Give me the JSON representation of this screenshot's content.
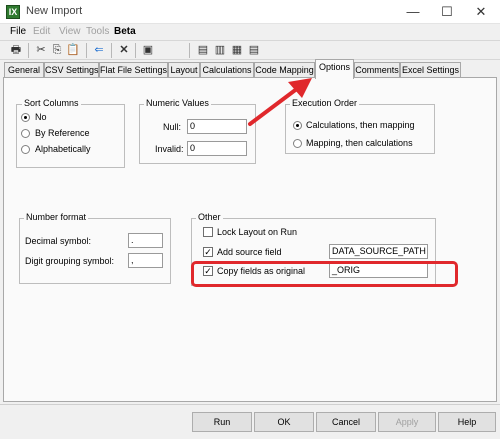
{
  "window": {
    "app_icon": "IX",
    "title": "New Import",
    "controls": {
      "minimize": "—",
      "maximize": "☐",
      "close": "✕"
    }
  },
  "menu": {
    "items": [
      "File",
      "Edit",
      "View",
      "Tools",
      "Beta"
    ],
    "disabled": [
      "Edit",
      "View",
      "Tools"
    ]
  },
  "toolbar": {
    "icons": [
      "print-icon",
      "cut-icon",
      "copy-icon",
      "paste-icon",
      "back-arrow-icon",
      "delete-icon",
      "properties-icon",
      "layout-view-1-icon",
      "layout-view-2-icon",
      "layout-view-3-icon"
    ],
    "glyphs": {
      "print": "🖶",
      "cut": "✂",
      "copy": "⎘",
      "paste": "📋",
      "back": "⇐",
      "delete": "✕",
      "properties": "▣",
      "view1": "▤",
      "view2": "▥",
      "view3": "▦"
    }
  },
  "tabs": {
    "items": [
      "General",
      "CSV Settings",
      "Flat File Settings",
      "Layout",
      "Calculations",
      "Code Mapping",
      "Options",
      "Comments",
      "Excel Settings"
    ],
    "active": "Options"
  },
  "sort_columns": {
    "title": "Sort Columns",
    "options": [
      "No",
      "By Reference",
      "Alphabetically"
    ],
    "selected": "No"
  },
  "numeric_values": {
    "title": "Numeric Values",
    "null_label": "Null:",
    "null_value": "0",
    "invalid_label": "Invalid:",
    "invalid_value": "0"
  },
  "execution_order": {
    "title": "Execution Order",
    "options": [
      "Calculations, then mapping",
      "Mapping, then calculations"
    ],
    "selected": "Calculations, then mapping"
  },
  "number_format": {
    "title": "Number format",
    "decimal_label": "Decimal symbol:",
    "decimal_value": ".",
    "grouping_label": "Digit grouping symbol:",
    "grouping_value": ","
  },
  "other": {
    "title": "Other",
    "lock_layout_label": "Lock Layout on Run",
    "lock_layout_checked": false,
    "add_source_label": "Add source field",
    "add_source_checked": true,
    "add_source_value": "DATA_SOURCE_PATH",
    "copy_fields_label": "Copy fields as original",
    "copy_fields_checked": true,
    "copy_fields_value": "_ORIG"
  },
  "footer": {
    "buttons": [
      "Run",
      "OK",
      "Cancel",
      "Apply",
      "Help"
    ],
    "disabled": [
      "Apply"
    ]
  },
  "annotation_colors": {
    "highlight": "#e0282c",
    "arrow": "#e0282c"
  }
}
